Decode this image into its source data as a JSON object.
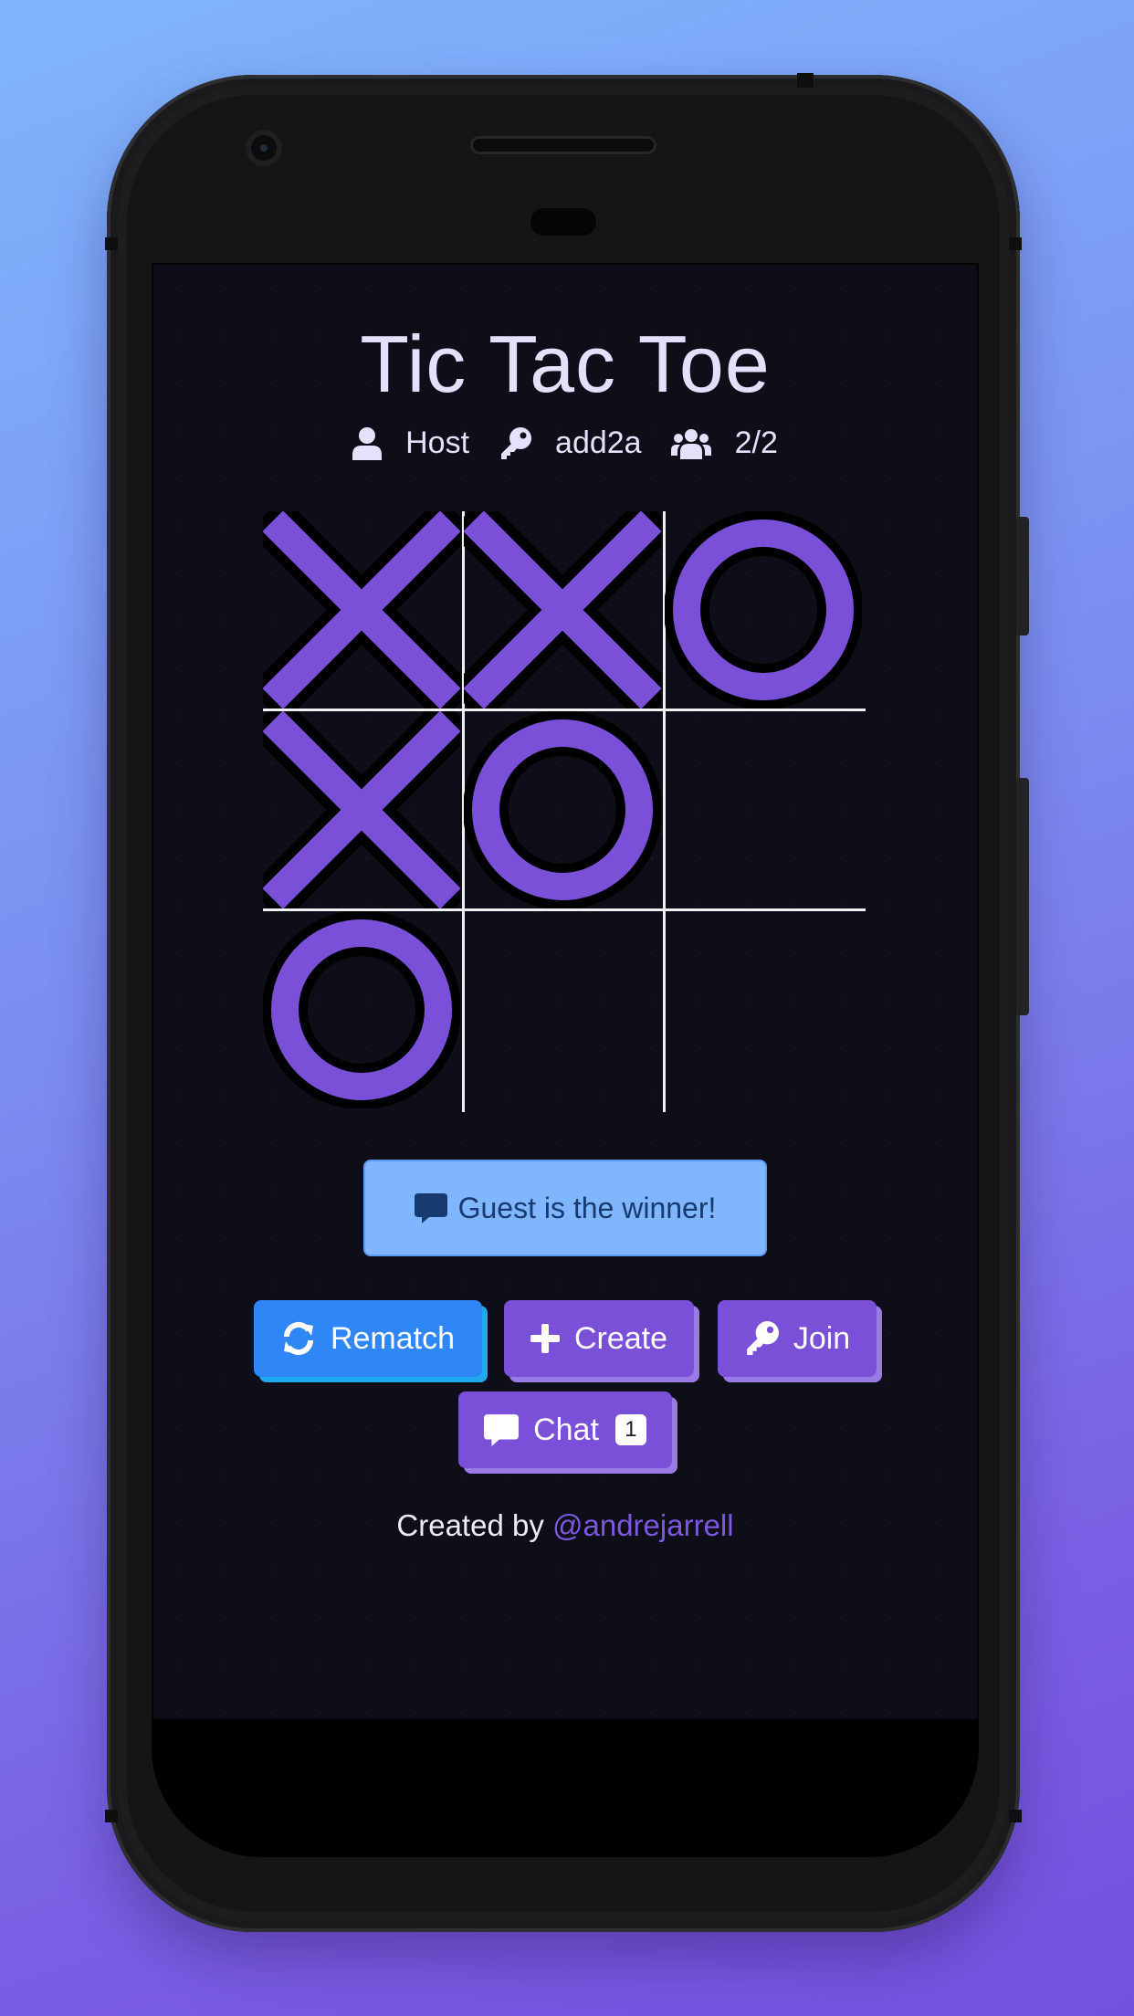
{
  "game": {
    "title": "Tic Tac Toe",
    "host_label": "Host",
    "room_code": "add2a",
    "players": "2/2",
    "board": [
      "X",
      "X",
      "O",
      "X",
      "O",
      "",
      "O",
      "",
      ""
    ],
    "status_message": "Guest is the winner!"
  },
  "actions": {
    "rematch_label": "Rematch",
    "create_label": "Create",
    "join_label": "Join",
    "chat_label": "Chat",
    "chat_count": "1"
  },
  "footer": {
    "prefix": "Created by ",
    "author": "@andrejarrell"
  },
  "colors": {
    "mark": "#7a50d8",
    "screen_bg": "#0d0e17",
    "status_bg": "#80b6fd",
    "rematch_bg": "#2f86f6"
  },
  "icons": {
    "host": "user-icon",
    "room": "key-icon",
    "players": "users-icon",
    "status": "comment-icon",
    "rematch": "sync-icon",
    "create": "plus-icon",
    "join": "key-icon",
    "chat": "comment-icon"
  }
}
